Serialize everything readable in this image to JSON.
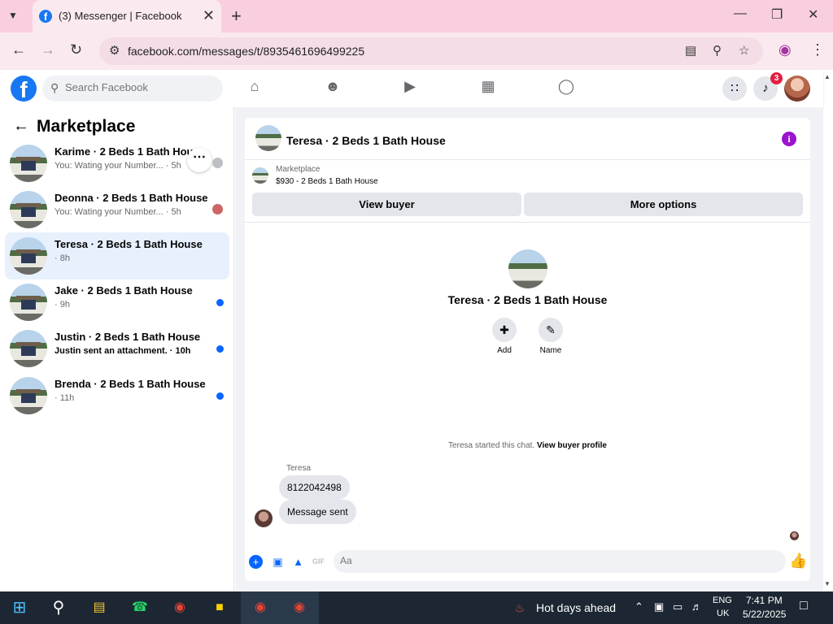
{
  "browser": {
    "tab_title": "(3) Messenger | Facebook",
    "url": "facebook.com/messages/t/8935461696499225"
  },
  "facebook": {
    "search_placeholder": "Search Facebook",
    "notification_count": "3"
  },
  "sidebar": {
    "title": "Marketplace",
    "conversations": [
      {
        "name": "Karime · 2 Beds 1 Bath House",
        "preview": "You: Wating your Number... · 5h",
        "unread": false
      },
      {
        "name": "Deonna · 2 Beds 1 Bath House",
        "preview": "You: Wating your Number... · 5h",
        "unread": false
      },
      {
        "name": "Teresa · 2 Beds 1 Bath House",
        "preview": "· 8h",
        "unread": false
      },
      {
        "name": "Jake · 2 Beds 1 Bath House",
        "preview": "· 9h",
        "unread": true
      },
      {
        "name": "Justin · 2 Beds 1 Bath House",
        "preview": "Justin sent an attachment. · 10h",
        "unread": true
      },
      {
        "name": "Brenda · 2 Beds 1 Bath House",
        "preview": "· 11h",
        "unread": true
      }
    ]
  },
  "chat": {
    "title": "Teresa · 2 Beds 1 Bath House",
    "marketplace_label": "Marketplace",
    "listing": "$930 - 2 Beds 1 Bath House",
    "view_buyer_button": "View buyer",
    "more_options_button": "More options",
    "profile_name": "Teresa · 2 Beds 1 Bath House",
    "add_label": "Add",
    "name_label": "Name",
    "started_text": "Teresa started this chat.",
    "view_buyer_profile_link": "View buyer profile",
    "sender_name": "Teresa",
    "messages": [
      "8122042498",
      "Message sent"
    ],
    "composer_placeholder": "Aa"
  },
  "taskbar": {
    "weather": "Hot days ahead",
    "lang_line1": "ENG",
    "lang_line2": "UK",
    "time": "7:41 PM",
    "date": "5/22/2025"
  },
  "colors": {
    "facebook_blue": "#1877f2",
    "messenger_blue": "#0866ff",
    "chrome_tabstrip": "#f9cfe0",
    "notification_red": "#e41e3f",
    "info_purple": "#9b14ce"
  }
}
